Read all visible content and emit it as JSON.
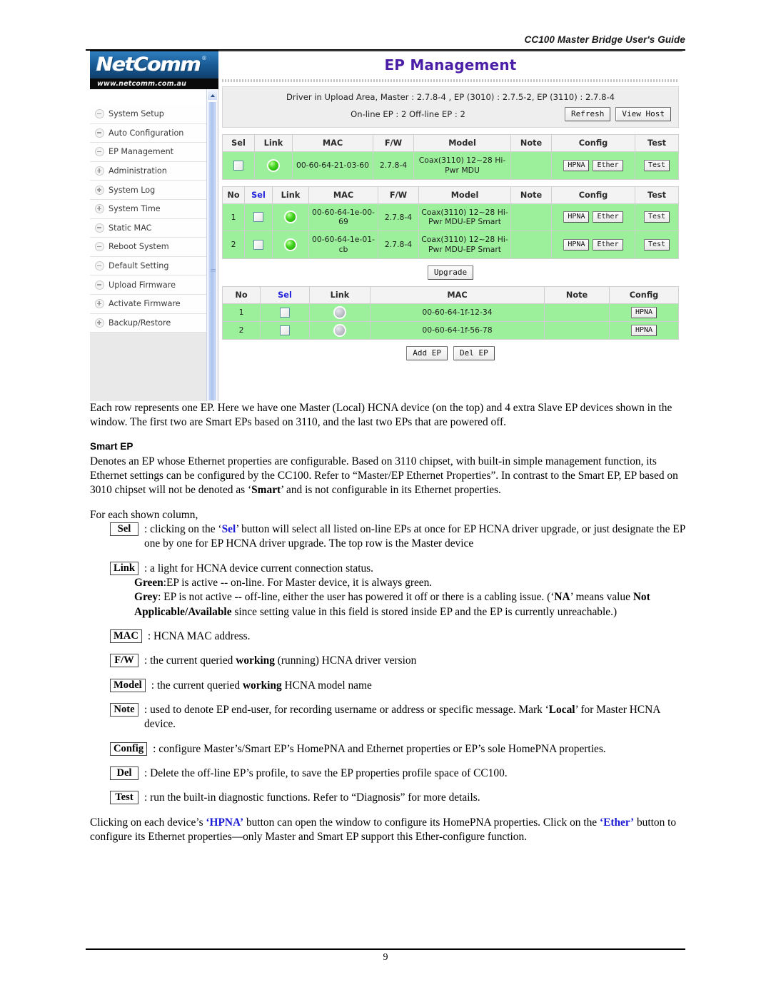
{
  "document": {
    "running_head": "CC100 Master Bridge User's Guide",
    "page_number": "9"
  },
  "screenshot": {
    "logo": {
      "brand": "NetComm",
      "registered": "®",
      "url": "www.netcomm.com.au"
    },
    "sidebar": {
      "items": [
        {
          "label": "System Setup",
          "icon": "minus-circle-icon"
        },
        {
          "label": "Auto Configuration",
          "icon": "minus-circle-icon"
        },
        {
          "label": "EP Management",
          "icon": "minus-circle-icon"
        },
        {
          "label": "Administration",
          "icon": "plus-circle-icon"
        },
        {
          "label": "System Log",
          "icon": "plus-circle-icon"
        },
        {
          "label": "System Time",
          "icon": "plus-circle-icon"
        },
        {
          "label": "Static MAC",
          "icon": "minus-circle-icon"
        },
        {
          "label": "Reboot System",
          "icon": "minus-circle-icon"
        },
        {
          "label": "Default Setting",
          "icon": "minus-circle-icon"
        },
        {
          "label": "Upload Firmware",
          "icon": "minus-circle-icon"
        },
        {
          "label": "Activate Firmware",
          "icon": "plus-circle-icon"
        },
        {
          "label": "Backup/Restore",
          "icon": "plus-circle-icon"
        }
      ]
    },
    "page_title": "EP Management",
    "status": {
      "driver_line": "Driver in Upload Area, Master : 2.7.8-4 ,  EP (3010) : 2.7.5-2,  EP (3110) : 2.7.8-4",
      "counts_line": "On-line EP : 2   Off-line EP : 2",
      "refresh_label": "Refresh",
      "view_host_label": "View Host"
    },
    "master_table": {
      "headers": [
        "Sel",
        "Link",
        "MAC",
        "F/W",
        "Model",
        "Note",
        "Config",
        "Test"
      ],
      "rows": [
        {
          "link": "green",
          "mac": "00-60-64-21-03-60",
          "fw": "2.7.8-4",
          "model": "Coax(3110) 12~28 Hi-Pwr MDU",
          "note": "",
          "config": [
            "HPNA",
            "Ether"
          ],
          "test": "Test"
        }
      ]
    },
    "online_table": {
      "headers": [
        "No",
        "Sel",
        "Link",
        "MAC",
        "F/W",
        "Model",
        "Note",
        "Config",
        "Test"
      ],
      "rows": [
        {
          "no": "1",
          "link": "green",
          "mac": "00-60-64-1e-00-69",
          "fw": "2.7.8-4",
          "model": "Coax(3110) 12~28 Hi-Pwr MDU-EP Smart",
          "note": "",
          "config": [
            "HPNA",
            "Ether"
          ],
          "test": "Test"
        },
        {
          "no": "2",
          "link": "green",
          "mac": "00-60-64-1e-01-cb",
          "fw": "2.7.8-4",
          "model": "Coax(3110) 12~28 Hi-Pwr MDU-EP Smart",
          "note": "",
          "config": [
            "HPNA",
            "Ether"
          ],
          "test": "Test"
        }
      ],
      "upgrade_label": "Upgrade"
    },
    "offline_table": {
      "headers": [
        "No",
        "Sel",
        "Link",
        "MAC",
        "Note",
        "Config"
      ],
      "rows": [
        {
          "no": "1",
          "link": "grey",
          "mac": "00-60-64-1f-12-34",
          "note": "",
          "config": [
            "HPNA"
          ]
        },
        {
          "no": "2",
          "link": "grey",
          "mac": "00-60-64-1f-56-78",
          "note": "",
          "config": [
            "HPNA"
          ]
        }
      ],
      "add_label": "Add EP",
      "del_label": "Del EP"
    }
  },
  "text": {
    "intro": "Each row represents one EP. Here we have one Master (Local) HCNA device (on the top) and 4 extra Slave EP devices shown in the window. The first two are Smart EPs based on 3110, and the last two EPs that are powered off.",
    "smart_ep_heading": "Smart EP",
    "smart_ep_body_1": "Denotes an EP whose Ethernet properties are configurable. Based on 3110 chipset, with built-in simple management function, its Ethernet settings can be configured by the CC100. Refer to “Master/EP Ethernet Properties”. In contrast to the Smart EP, EP based on 3010 chipset will not be denoted as ‘",
    "smart_ep_bold": "Smart",
    "smart_ep_body_2": "’ and is not configurable in its Ethernet properties.",
    "for_each_column": "For each shown column,",
    "defs": {
      "sel": {
        "tag": "Sel",
        "text_1": ": clicking on the ‘",
        "link_word": "Sel",
        "text_2": "’ button will select all listed on-line EPs at once for EP HCNA driver upgrade, or just designate the EP one by one for EP HCNA driver upgrade. The top row is the Master device"
      },
      "link": {
        "tag": "Link",
        "text": ": a light for HCNA device current connection status.",
        "green_label": "Green",
        "green_text": ":EP is active -- on-line.  For Master device, it is always green.",
        "grey_label": "Grey",
        "grey_text_1": ": EP is not active -- off-line, either the user has powered it off or there is a cabling issue. (‘",
        "grey_na": "NA",
        "grey_text_2": "’ means value ",
        "grey_bold": "Not Applicable/Available",
        "grey_text_3": " since setting value in this field is stored inside EP and the EP is currently unreachable.)"
      },
      "mac": {
        "tag": "MAC",
        "text": ": HCNA MAC address."
      },
      "fw": {
        "tag": "F/W",
        "text_1": ": the current queried ",
        "bold": "working",
        "text_2": " (running) HCNA driver version"
      },
      "model": {
        "tag": "Model",
        "text_1": ": the current queried ",
        "bold": "working",
        "text_2": " HCNA model name"
      },
      "note": {
        "tag": "Note",
        "text_1": ": used to denote EP end-user, for recording username or address or specific message. Mark ‘",
        "bold": "Local",
        "text_2": "’ for Master HCNA device."
      },
      "config": {
        "tag": "Config",
        "text": ": configure Master’s/Smart EP’s HomePNA and Ethernet properties or EP’s sole HomePNA properties."
      },
      "del": {
        "tag": "Del",
        "text": ": Delete the off-line EP’s profile, to save the EP properties profile space of CC100."
      },
      "test": {
        "tag": "Test",
        "text": ": run the built-in diagnostic functions.  Refer to “Diagnosis” for more details."
      }
    },
    "closing_1": "Clicking on each device’s ",
    "closing_hpna": "‘HPNA’",
    "closing_2": " button can open the window to configure its HomePNA properties. Click on the ",
    "closing_ether": "‘Ether’",
    "closing_3": " button to configure its Ethernet properties—only Master and Smart EP support this Ether-configure function."
  },
  "colors": {
    "row_green": "#9cf09c",
    "title_purple": "#4b1ea8",
    "link_blue": "#2222dd",
    "logo_blue": "#1b5e9e"
  }
}
